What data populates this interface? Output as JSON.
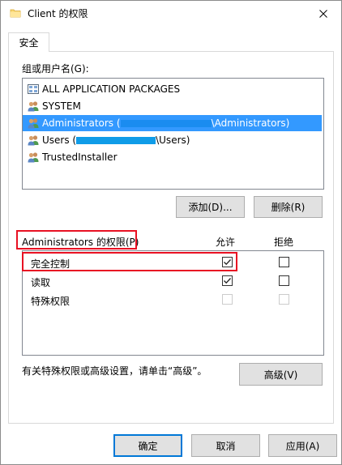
{
  "window": {
    "title": "Client 的权限",
    "close_icon": "close-icon"
  },
  "tabs": [
    {
      "label": "安全",
      "active": true
    }
  ],
  "groups": {
    "label": "组或用户名(G):",
    "items": [
      {
        "name": "ALL APPLICATION PACKAGES",
        "icon": "package-icon",
        "selected": false
      },
      {
        "name": "SYSTEM",
        "icon": "users-icon",
        "selected": false
      },
      {
        "prefix": "Administrators (",
        "suffix": "\\Administrators)",
        "icon": "users-icon",
        "selected": true
      },
      {
        "prefix": "Users (",
        "suffix": "\\Users)",
        "icon": "users-icon",
        "selected": false
      },
      {
        "name": "TrustedInstaller",
        "icon": "users-icon",
        "selected": false
      }
    ]
  },
  "buttons": {
    "add": "添加(D)...",
    "remove": "删除(R)",
    "advanced": "高级(V)",
    "ok": "确定",
    "cancel": "取消",
    "apply": "应用(A)"
  },
  "permissions": {
    "label": "Administrators 的权限(P)",
    "allow_header": "允许",
    "deny_header": "拒绝",
    "rows": [
      {
        "name": "完全控制",
        "allow": true,
        "deny": false,
        "disabled": false
      },
      {
        "name": "读取",
        "allow": true,
        "deny": false,
        "disabled": false
      },
      {
        "name": "特殊权限",
        "allow": false,
        "deny": false,
        "disabled": true
      }
    ]
  },
  "advanced_note": "有关特殊权限或高级设置，请单击“高级”。",
  "colors": {
    "selection": "#3399ff",
    "redaction": "#0f9ce8",
    "highlight_box": "#e81123",
    "default_button_border": "#0078d7"
  }
}
